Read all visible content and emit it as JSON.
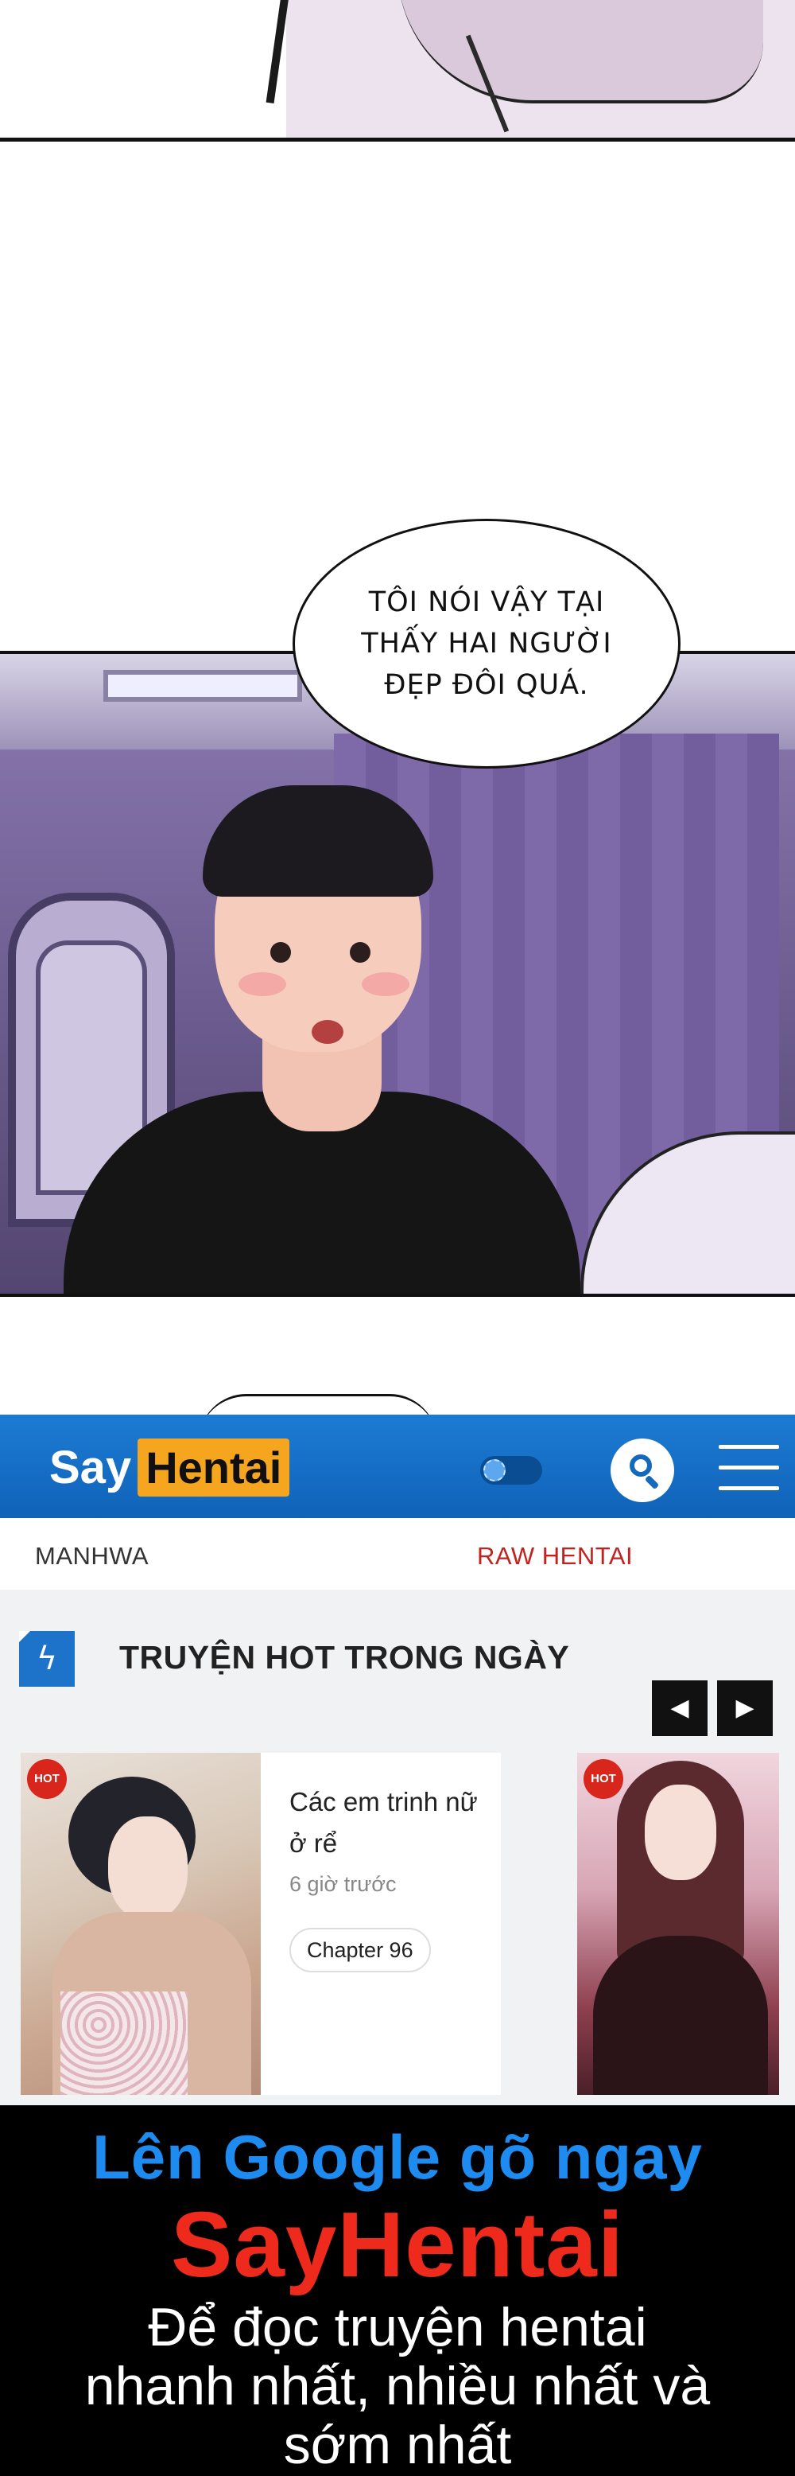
{
  "comic": {
    "speech_bubble": "TÔI NÓI VẬY TẠI\nTHẤY HAI NGƯỜI\nĐẸP ĐÔI QUÁ."
  },
  "site_header": {
    "logo_say": "Say",
    "logo_hentai": "Hentai",
    "brand_color": "#1469bd",
    "logo_accent": "#f6a51e",
    "icons": [
      "theme-toggle-icon",
      "search-icon",
      "hamburger-menu-icon"
    ]
  },
  "categories": {
    "manhwa": "MANHWA",
    "raw_hentai": "RAW HENTAI",
    "raw_hentai_color": "#c3221e"
  },
  "hot_section": {
    "title": "TRUYỆN HOT TRONG NGÀY",
    "prev_arrow": "◀",
    "next_arrow": "▶",
    "cards": [
      {
        "badge": "HOT",
        "title": "Các em trinh nữ ở rể",
        "time": "6 giờ trước",
        "chapter": "Chapter 96"
      },
      {
        "badge": "HOT"
      }
    ]
  },
  "promo": {
    "line1": "Lên Google gõ ngay",
    "line2": "SayHentai",
    "line3": "Để đọc truyện hentai\nnhanh nhất, nhiều nhất và\nsớm nhất",
    "line1_color": "#1e8bf0",
    "line2_color": "#ee2a1c"
  }
}
